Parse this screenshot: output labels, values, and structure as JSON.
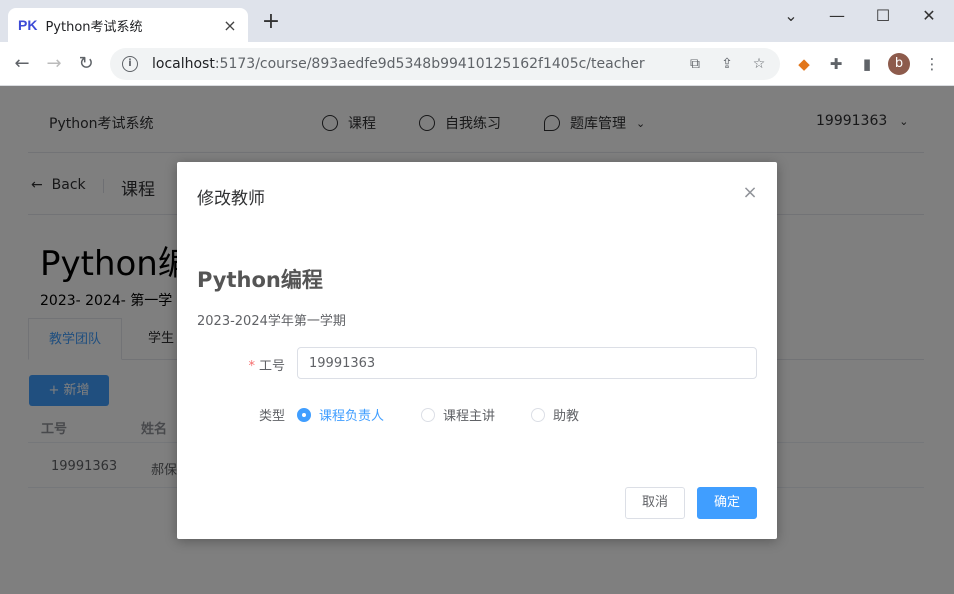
{
  "browser": {
    "tab_favicon": "PK",
    "tab_title": "Python考试系统",
    "tab_close": "×",
    "new_tab": "+",
    "url_host": "localhost",
    "url_path": ":5173/course/893aedfe9d5348b99410125162f1405c/teacher",
    "avatar_letter": "b",
    "window_controls": [
      "⌄",
      "—",
      "☐",
      "✕"
    ]
  },
  "app": {
    "brand": "Python考试系统",
    "nav": [
      {
        "label": "课程",
        "icon": "gear-icon"
      },
      {
        "label": "自我练习",
        "icon": "gear-icon"
      },
      {
        "label": "题库管理",
        "icon": "location-icon"
      }
    ],
    "user": "19991363"
  },
  "page": {
    "back_label": "Back",
    "breadcrumb": "课程",
    "course_title": "Python编",
    "course_term": "2023- 2024- 第一学",
    "tabs": [
      "教学团队",
      "学生"
    ],
    "add_button": "+ 新增",
    "table_headers": [
      "工号",
      "姓名"
    ],
    "table_rows": [
      [
        "19991363",
        "郝保"
      ]
    ]
  },
  "dialog": {
    "title": "修改教师",
    "course_name": "Python编程",
    "term": "2023-2024学年第一学期",
    "field_id_label": "工号",
    "field_id_value": "19991363",
    "field_type_label": "类型",
    "type_options": [
      "课程负责人",
      "课程主讲",
      "助教"
    ],
    "selected_type": "课程负责人",
    "cancel_label": "取消",
    "confirm_label": "确定"
  },
  "colors": {
    "primary": "#409eff",
    "required": "#f56c6c",
    "overlay": "rgba(0,0,0,0.5)"
  }
}
